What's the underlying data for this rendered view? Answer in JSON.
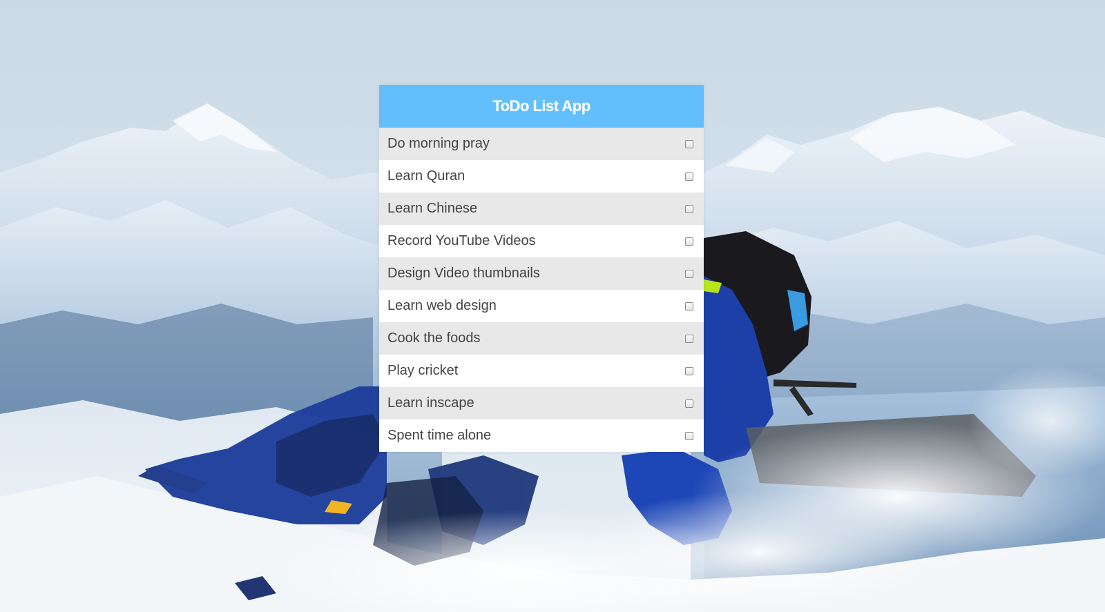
{
  "app": {
    "title": "ToDo List App"
  },
  "colors": {
    "header_bg": "#63bffb",
    "odd_row_bg": "#e8e8e8",
    "even_row_bg": "#ffffff",
    "text": "#444444"
  },
  "todos": [
    {
      "label": "Do morning pray",
      "checked": false
    },
    {
      "label": "Learn Quran",
      "checked": false
    },
    {
      "label": "Learn Chinese",
      "checked": false
    },
    {
      "label": "Record YouTube Videos",
      "checked": false
    },
    {
      "label": "Design Video thumbnails",
      "checked": false
    },
    {
      "label": "Learn web design",
      "checked": false
    },
    {
      "label": "Cook the foods",
      "checked": false
    },
    {
      "label": "Play cricket",
      "checked": false
    },
    {
      "label": "Learn inscape",
      "checked": false
    },
    {
      "label": "Spent time alone",
      "checked": false
    }
  ]
}
